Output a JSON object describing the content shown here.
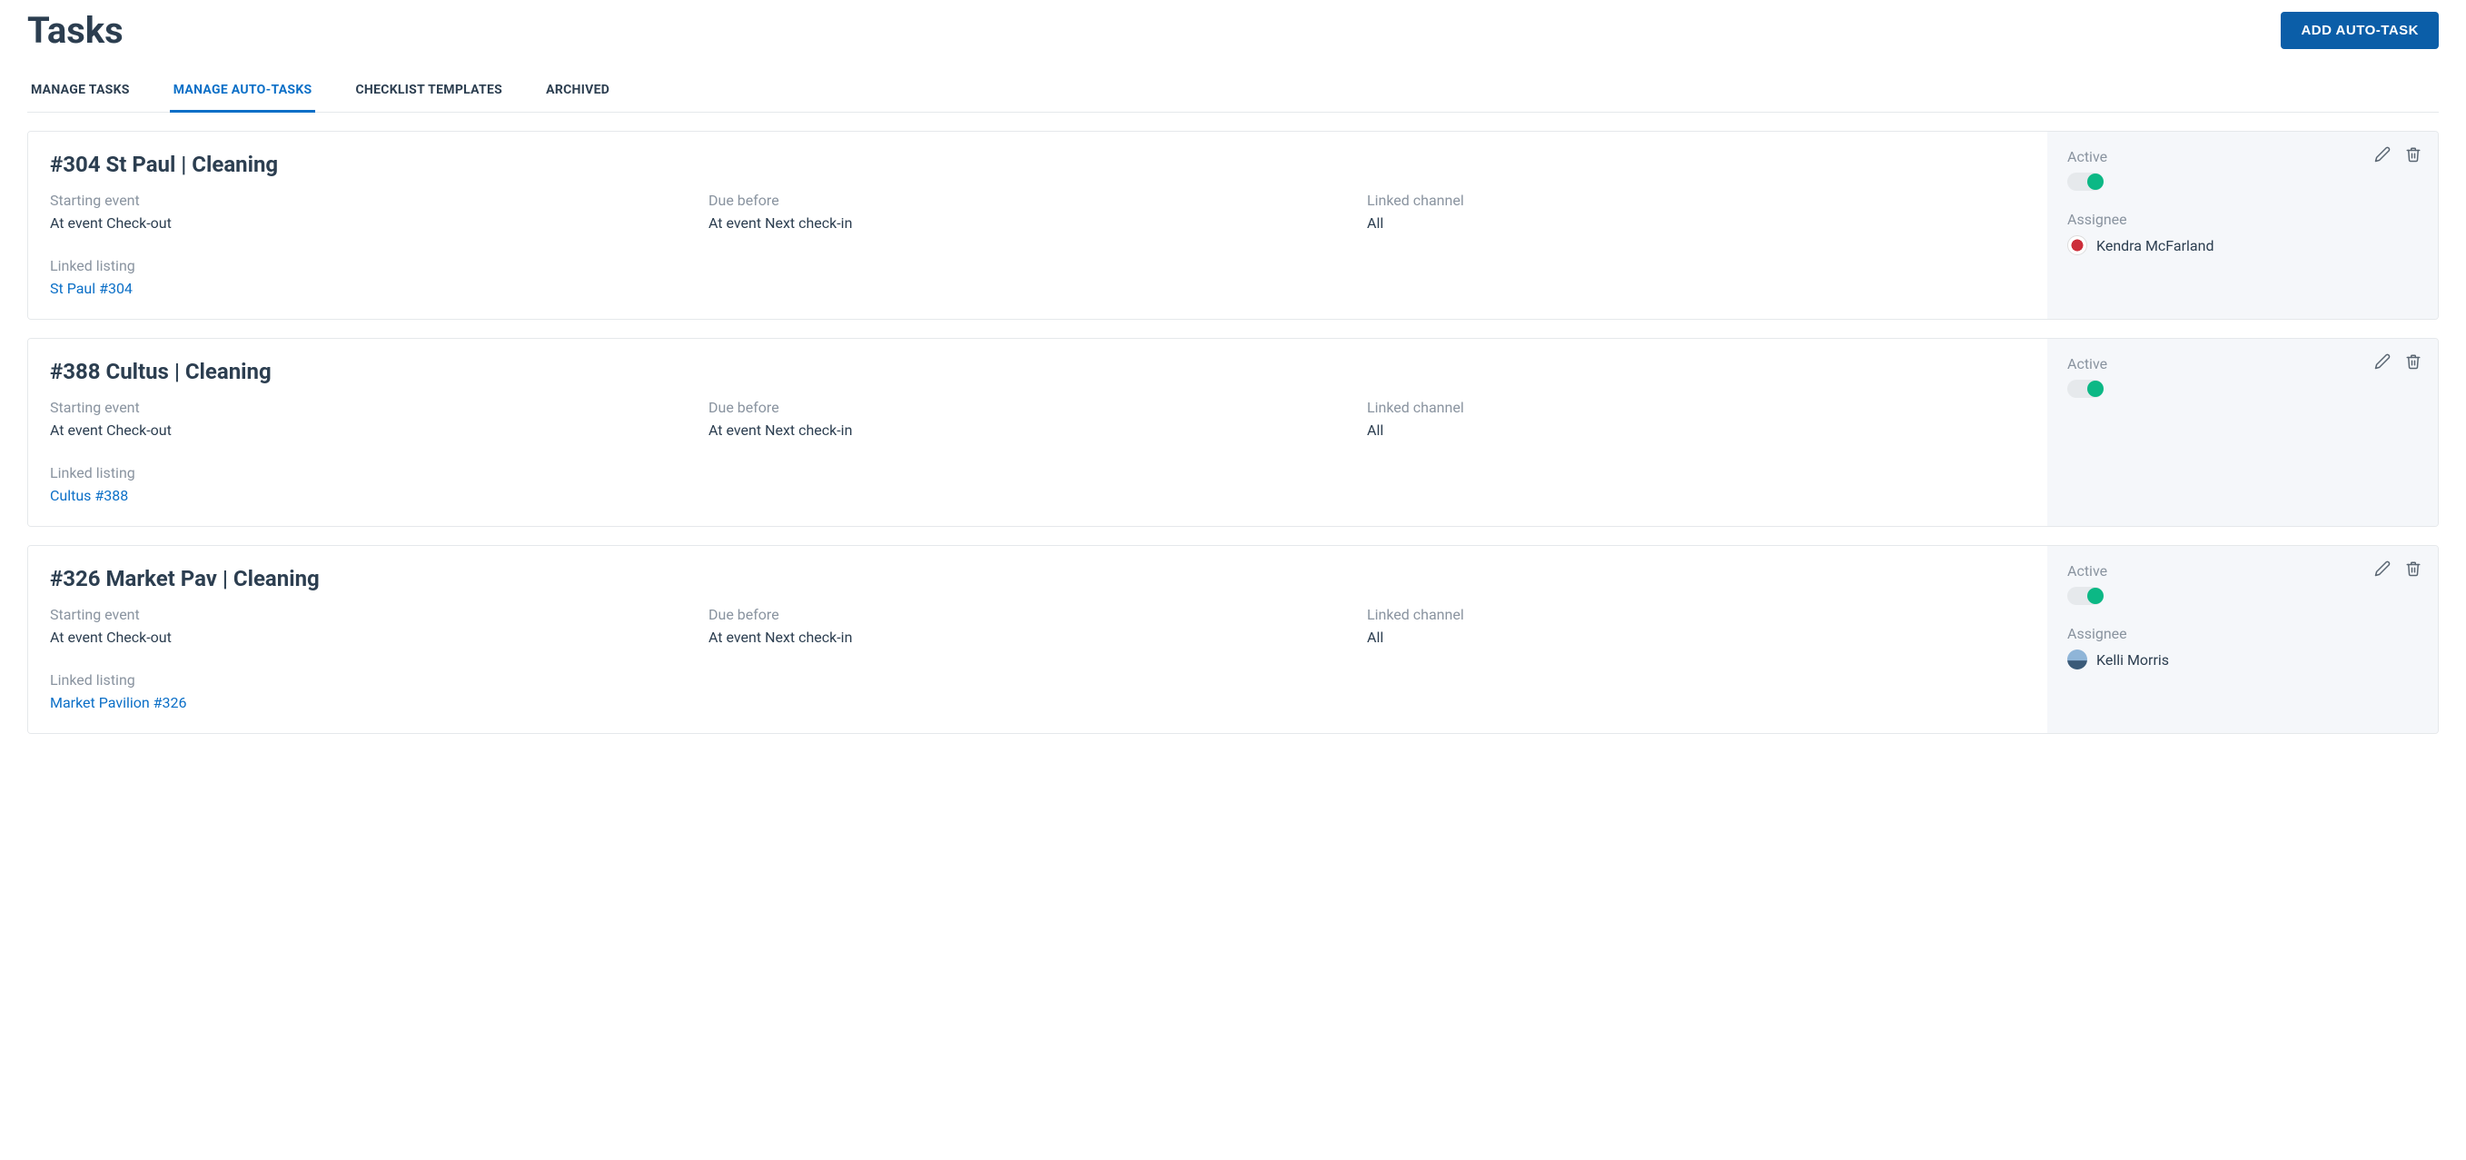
{
  "header": {
    "title": "Tasks",
    "addButton": "ADD AUTO-TASK"
  },
  "tabs": [
    {
      "label": "MANAGE TASKS",
      "active": false
    },
    {
      "label": "MANAGE AUTO-TASKS",
      "active": true
    },
    {
      "label": "CHECKLIST TEMPLATES",
      "active": false
    },
    {
      "label": "ARCHIVED",
      "active": false
    }
  ],
  "labels": {
    "starting_event": "Starting event",
    "due_before": "Due before",
    "linked_channel": "Linked channel",
    "linked_listing": "Linked listing",
    "active": "Active",
    "assignee": "Assignee"
  },
  "cards": [
    {
      "title": "#304 St Paul | Cleaning",
      "starting_event": "At event Check-out",
      "due_before": "At event Next check-in",
      "linked_channel": "All",
      "linked_listing": "St Paul #304",
      "active": true,
      "assignee": {
        "name": "Kendra McFarland",
        "avatarClass": "red"
      }
    },
    {
      "title": "#388 Cultus | Cleaning",
      "starting_event": "At event Check-out",
      "due_before": "At event Next check-in",
      "linked_channel": "All",
      "linked_listing": "Cultus #388",
      "active": true,
      "assignee": null
    },
    {
      "title": "#326 Market Pav | Cleaning",
      "starting_event": "At event Check-out",
      "due_before": "At event Next check-in",
      "linked_channel": "All",
      "linked_listing": "Market Pavilion #326",
      "active": true,
      "assignee": {
        "name": "Kelli Morris",
        "avatarClass": "blue"
      }
    }
  ]
}
